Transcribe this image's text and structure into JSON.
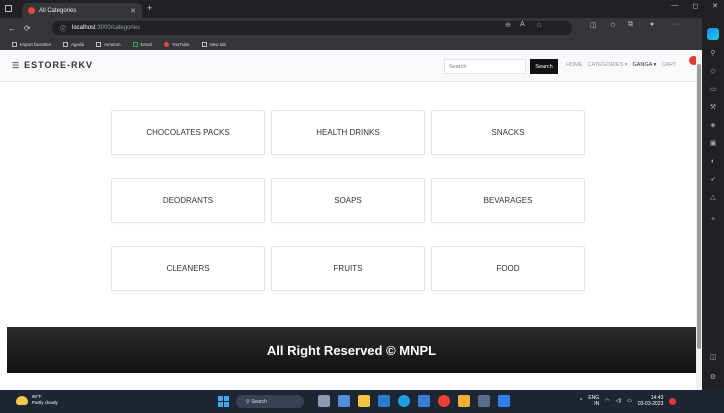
{
  "browser": {
    "tab_title": "All Categories",
    "url_host": "localhost",
    "url_path": ":3000/categories",
    "bookmarks": [
      "Import favorites",
      "Agoda",
      "Amazon",
      "Email",
      "YouTube",
      "New tab"
    ]
  },
  "navbar": {
    "brand": "ESTORE-RKV",
    "search_placeholder": "Search",
    "search_button": "Search",
    "links": [
      "HOME",
      "CATEGORIES ▾",
      "GANGA ▾",
      "CART"
    ]
  },
  "categories": [
    "CHOCOLATES PACKS",
    "HEALTH DRINKS",
    "SNACKS",
    "DEODRANTS",
    "SOAPS",
    "BEVARAGES",
    "CLEANERS",
    "FRUITS",
    "FOOD"
  ],
  "footer": {
    "text": "All Right Reserved © MNPL"
  },
  "taskbar": {
    "weather_temp": "90°F",
    "weather_desc": "Partly cloudy",
    "search_label": "Search",
    "lang_top": "ENG",
    "lang_bottom": "IN",
    "time": "14:43",
    "date": "03-03-2023"
  },
  "colors": {
    "search_button_bg": "#111111",
    "footer_bg": "#1e1e1e",
    "page_bg": "#ffffff"
  }
}
